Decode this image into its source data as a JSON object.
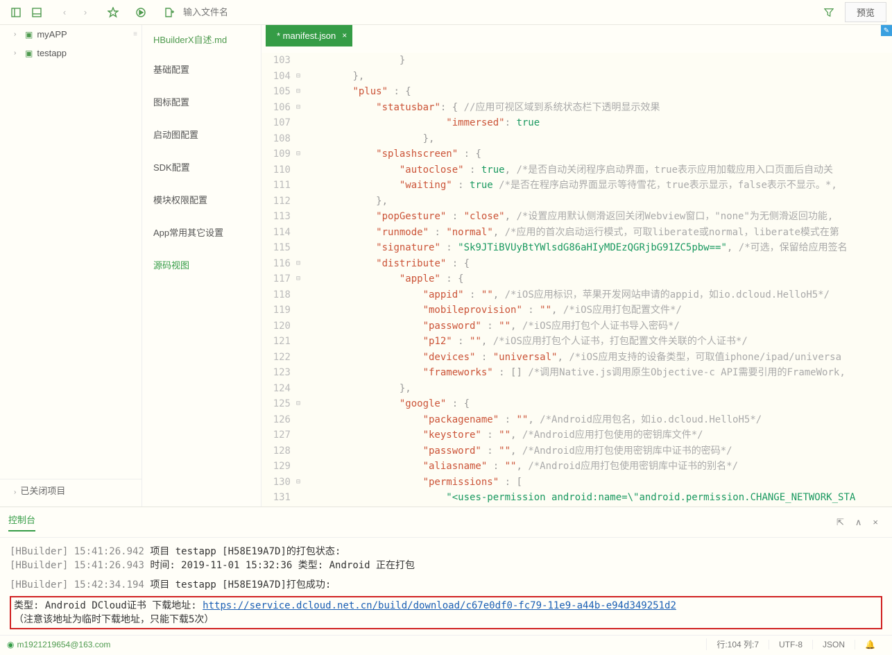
{
  "toolbar": {
    "filename_placeholder": "输入文件名",
    "preview_label": "预览"
  },
  "tree": {
    "items": [
      {
        "label": "myAPP"
      },
      {
        "label": "testapp"
      }
    ],
    "closed_label": "已关闭项目"
  },
  "config_tabs": {
    "inactive_tab": "HBuilderX自述.md",
    "items": [
      "基础配置",
      "图标配置",
      "启动图配置",
      "SDK配置",
      "模块权限配置",
      "App常用其它设置",
      "源码视图"
    ]
  },
  "editor": {
    "active_tab": "* manifest.json",
    "lines": [
      {
        "n": 103,
        "f": "",
        "indent": 4,
        "seg": [
          {
            "t": "}",
            "cls": "p"
          }
        ]
      },
      {
        "n": 104,
        "f": "⊟",
        "indent": 2,
        "seg": [
          {
            "t": "},",
            "cls": "p"
          }
        ]
      },
      {
        "n": 105,
        "f": "⊟",
        "indent": 2,
        "seg": [
          {
            "t": "\"plus\"",
            "cls": "k"
          },
          {
            "t": " : {",
            "cls": "p"
          }
        ]
      },
      {
        "n": 106,
        "f": "⊟",
        "indent": 3,
        "seg": [
          {
            "t": "\"statusbar\"",
            "cls": "k"
          },
          {
            "t": ": { ",
            "cls": "p"
          },
          {
            "t": "//应用可视区域到系统状态栏下透明显示效果",
            "cls": "c"
          }
        ]
      },
      {
        "n": 107,
        "f": "",
        "indent": 6,
        "seg": [
          {
            "t": "\"immersed\"",
            "cls": "k"
          },
          {
            "t": ": ",
            "cls": "p"
          },
          {
            "t": "true",
            "cls": "b"
          }
        ]
      },
      {
        "n": 108,
        "f": "",
        "indent": 5,
        "seg": [
          {
            "t": "},",
            "cls": "p"
          }
        ]
      },
      {
        "n": 109,
        "f": "⊟",
        "indent": 3,
        "seg": [
          {
            "t": "\"splashscreen\"",
            "cls": "k"
          },
          {
            "t": " : {",
            "cls": "p"
          }
        ]
      },
      {
        "n": 110,
        "f": "",
        "indent": 4,
        "seg": [
          {
            "t": "\"autoclose\"",
            "cls": "k"
          },
          {
            "t": " : ",
            "cls": "p"
          },
          {
            "t": "true",
            "cls": "b"
          },
          {
            "t": ", ",
            "cls": "p"
          },
          {
            "t": "/*是否自动关闭程序启动界面，true表示应用加载应用入口页面后自动关",
            "cls": "c"
          }
        ]
      },
      {
        "n": 111,
        "f": "",
        "indent": 4,
        "seg": [
          {
            "t": "\"waiting\"",
            "cls": "k"
          },
          {
            "t": " : ",
            "cls": "p"
          },
          {
            "t": "true",
            "cls": "b"
          },
          {
            "t": " ",
            "cls": "p"
          },
          {
            "t": "/*是否在程序启动界面显示等待雪花，true表示显示，false表示不显示。*,",
            "cls": "c"
          }
        ]
      },
      {
        "n": 112,
        "f": "",
        "indent": 3,
        "seg": [
          {
            "t": "},",
            "cls": "p"
          }
        ]
      },
      {
        "n": 113,
        "f": "",
        "indent": 3,
        "seg": [
          {
            "t": "\"popGesture\"",
            "cls": "k"
          },
          {
            "t": " : ",
            "cls": "p"
          },
          {
            "t": "\"close\"",
            "cls": "k"
          },
          {
            "t": ", ",
            "cls": "p"
          },
          {
            "t": "/*设置应用默认侧滑返回关闭Webview窗口，\"none\"为无侧滑返回功能,",
            "cls": "c"
          }
        ]
      },
      {
        "n": 114,
        "f": "",
        "indent": 3,
        "seg": [
          {
            "t": "\"runmode\"",
            "cls": "k"
          },
          {
            "t": " : ",
            "cls": "p"
          },
          {
            "t": "\"normal\"",
            "cls": "k"
          },
          {
            "t": ", ",
            "cls": "p"
          },
          {
            "t": "/*应用的首次启动运行模式，可取liberate或normal，liberate模式在第",
            "cls": "c"
          }
        ]
      },
      {
        "n": 115,
        "f": "",
        "indent": 3,
        "seg": [
          {
            "t": "\"signature\"",
            "cls": "k"
          },
          {
            "t": " : ",
            "cls": "p"
          },
          {
            "t": "\"Sk9JTiBVUyBtYWlsdG86aHIyMDEzQGRjbG91ZC5pbw==\"",
            "cls": "s"
          },
          {
            "t": ", ",
            "cls": "p"
          },
          {
            "t": "/*可选，保留给应用签名",
            "cls": "c"
          }
        ]
      },
      {
        "n": 116,
        "f": "⊟",
        "indent": 3,
        "seg": [
          {
            "t": "\"distribute\"",
            "cls": "k"
          },
          {
            "t": " : {",
            "cls": "p"
          }
        ]
      },
      {
        "n": 117,
        "f": "⊟",
        "indent": 4,
        "seg": [
          {
            "t": "\"apple\"",
            "cls": "k"
          },
          {
            "t": " : {",
            "cls": "p"
          }
        ]
      },
      {
        "n": 118,
        "f": "",
        "indent": 5,
        "seg": [
          {
            "t": "\"appid\"",
            "cls": "k"
          },
          {
            "t": " : ",
            "cls": "p"
          },
          {
            "t": "\"\"",
            "cls": "k"
          },
          {
            "t": ", ",
            "cls": "p"
          },
          {
            "t": "/*iOS应用标识，苹果开发网站申请的appid，如io.dcloud.HelloH5*/",
            "cls": "c"
          }
        ]
      },
      {
        "n": 119,
        "f": "",
        "indent": 5,
        "seg": [
          {
            "t": "\"mobileprovision\"",
            "cls": "k"
          },
          {
            "t": " : ",
            "cls": "p"
          },
          {
            "t": "\"\"",
            "cls": "k"
          },
          {
            "t": ", ",
            "cls": "p"
          },
          {
            "t": "/*iOS应用打包配置文件*/",
            "cls": "c"
          }
        ]
      },
      {
        "n": 120,
        "f": "",
        "indent": 5,
        "seg": [
          {
            "t": "\"password\"",
            "cls": "k"
          },
          {
            "t": " : ",
            "cls": "p"
          },
          {
            "t": "\"\"",
            "cls": "k"
          },
          {
            "t": ", ",
            "cls": "p"
          },
          {
            "t": "/*iOS应用打包个人证书导入密码*/",
            "cls": "c"
          }
        ]
      },
      {
        "n": 121,
        "f": "",
        "indent": 5,
        "seg": [
          {
            "t": "\"p12\"",
            "cls": "k"
          },
          {
            "t": " : ",
            "cls": "p"
          },
          {
            "t": "\"\"",
            "cls": "k"
          },
          {
            "t": ", ",
            "cls": "p"
          },
          {
            "t": "/*iOS应用打包个人证书，打包配置文件关联的个人证书*/",
            "cls": "c"
          }
        ]
      },
      {
        "n": 122,
        "f": "",
        "indent": 5,
        "seg": [
          {
            "t": "\"devices\"",
            "cls": "k"
          },
          {
            "t": " : ",
            "cls": "p"
          },
          {
            "t": "\"universal\"",
            "cls": "k"
          },
          {
            "t": ", ",
            "cls": "p"
          },
          {
            "t": "/*iOS应用支持的设备类型，可取值iphone/ipad/universa",
            "cls": "c"
          }
        ]
      },
      {
        "n": 123,
        "f": "",
        "indent": 5,
        "seg": [
          {
            "t": "\"frameworks\"",
            "cls": "k"
          },
          {
            "t": " : [] ",
            "cls": "p"
          },
          {
            "t": "/*调用Native.js调用原生Objective-c API需要引用的FrameWork,",
            "cls": "c"
          }
        ]
      },
      {
        "n": 124,
        "f": "",
        "indent": 4,
        "seg": [
          {
            "t": "},",
            "cls": "p"
          }
        ]
      },
      {
        "n": 125,
        "f": "⊟",
        "indent": 4,
        "seg": [
          {
            "t": "\"google\"",
            "cls": "k"
          },
          {
            "t": " : {",
            "cls": "p"
          }
        ]
      },
      {
        "n": 126,
        "f": "",
        "indent": 5,
        "seg": [
          {
            "t": "\"packagename\"",
            "cls": "k"
          },
          {
            "t": " : ",
            "cls": "p"
          },
          {
            "t": "\"\"",
            "cls": "k"
          },
          {
            "t": ", ",
            "cls": "p"
          },
          {
            "t": "/*Android应用包名，如io.dcloud.HelloH5*/",
            "cls": "c"
          }
        ]
      },
      {
        "n": 127,
        "f": "",
        "indent": 5,
        "seg": [
          {
            "t": "\"keystore\"",
            "cls": "k"
          },
          {
            "t": " : ",
            "cls": "p"
          },
          {
            "t": "\"\"",
            "cls": "k"
          },
          {
            "t": ", ",
            "cls": "p"
          },
          {
            "t": "/*Android应用打包使用的密钥库文件*/",
            "cls": "c"
          }
        ]
      },
      {
        "n": 128,
        "f": "",
        "indent": 5,
        "seg": [
          {
            "t": "\"password\"",
            "cls": "k"
          },
          {
            "t": " : ",
            "cls": "p"
          },
          {
            "t": "\"\"",
            "cls": "k"
          },
          {
            "t": ", ",
            "cls": "p"
          },
          {
            "t": "/*Android应用打包使用密钥库中证书的密码*/",
            "cls": "c"
          }
        ]
      },
      {
        "n": 129,
        "f": "",
        "indent": 5,
        "seg": [
          {
            "t": "\"aliasname\"",
            "cls": "k"
          },
          {
            "t": " : ",
            "cls": "p"
          },
          {
            "t": "\"\"",
            "cls": "k"
          },
          {
            "t": ", ",
            "cls": "p"
          },
          {
            "t": "/*Android应用打包使用密钥库中证书的别名*/",
            "cls": "c"
          }
        ]
      },
      {
        "n": 130,
        "f": "⊟",
        "indent": 5,
        "seg": [
          {
            "t": "\"permissions\"",
            "cls": "k"
          },
          {
            "t": " : [",
            "cls": "p"
          }
        ]
      },
      {
        "n": 131,
        "f": "",
        "indent": 6,
        "seg": [
          {
            "t": "\"<uses-permission android:name=\\\"android.permission.CHANGE_NETWORK_STA",
            "cls": "s"
          }
        ]
      }
    ]
  },
  "console": {
    "title": "控制台",
    "lines": [
      {
        "tag": "[HBuilder]",
        "ts": "15:41:26.942",
        "txt": " 项目 testapp [H58E19A7D]的打包状态:"
      },
      {
        "tag": "[HBuilder]",
        "ts": "15:41:26.943",
        "txt": " 时间: 2019-11-01 15:32:36    类型: Android    正在打包"
      }
    ],
    "box_tag": "[HBuilder]",
    "box_ts": "15:42:34.194",
    "box_txt1": " 项目 testapp [H58E19A7D]打包成功:",
    "box_txt2_pre": "    类型: Android DCloud证书 下载地址: ",
    "box_link": "https://service.dcloud.net.cn/build/download/c67e0df0-fc79-11e9-a44b-e94d349251d2",
    "box_txt2_post": " （注意该地址为临时下载地址，只能下载5次）"
  },
  "status": {
    "user": "m1921219654@163.com",
    "row_col": "行:104 列:7",
    "encoding": "UTF-8",
    "lang": "JSON"
  }
}
